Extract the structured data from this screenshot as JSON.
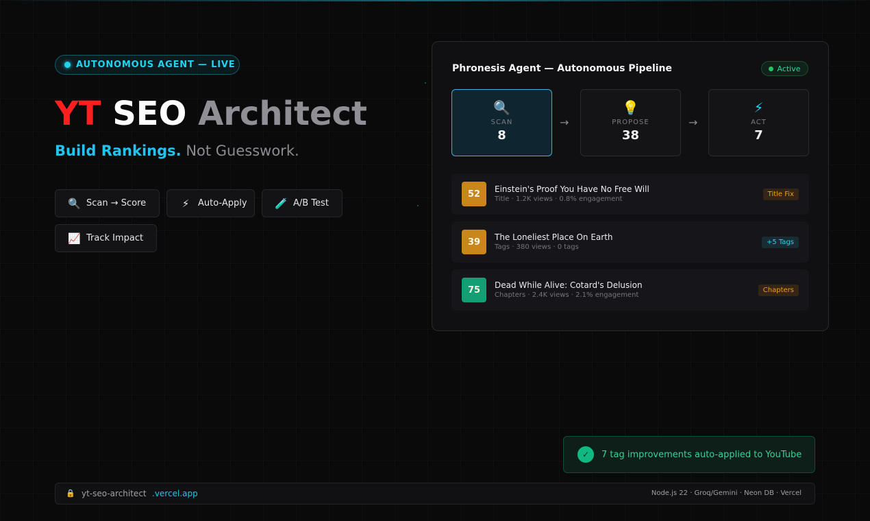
{
  "hero": {
    "badge": "AUTONOMOUS AGENT — LIVE",
    "title_part1": "YT",
    "title_part2": "SEO",
    "title_part3": "Architect",
    "tagline_strong": "Build Rankings.",
    "tagline_muted": "Not Guesswork.",
    "features": [
      {
        "icon": "search-icon",
        "glyph": "🔍",
        "label": "Scan → Score"
      },
      {
        "icon": "lightning-icon",
        "glyph": "⚡",
        "label": "Auto-Apply"
      },
      {
        "icon": "test-tube-icon",
        "glyph": "🧪",
        "label": "A/B Test"
      },
      {
        "icon": "chart-up-icon",
        "glyph": "📈",
        "label": "Track Impact"
      }
    ]
  },
  "pipeline": {
    "title": "Phronesis Agent — Autonomous Pipeline",
    "status": "Active",
    "stages": [
      {
        "icon": "search-icon",
        "glyph": "🔍",
        "label": "SCAN",
        "value": "8"
      },
      {
        "icon": "lightbulb-icon",
        "glyph": "💡",
        "label": "PROPOSE",
        "value": "38"
      },
      {
        "icon": "lightning-icon",
        "glyph": "⚡",
        "label": "ACT",
        "value": "7"
      }
    ],
    "arrow": "→",
    "videos": [
      {
        "score": "52",
        "title": "Einstein's Proof You Have No Free Will",
        "meta": "Title · 1.2K views · 0.8% engagement",
        "badge": "Title Fix"
      },
      {
        "score": "39",
        "title": "The Loneliest Place On Earth",
        "meta": "Tags · 380 views · 0 tags",
        "badge": "+5 Tags"
      },
      {
        "score": "75",
        "title": "Dead While Alive: Cotard's Delusion",
        "meta": "Chapters · 2.4K views · 2.1% engagement",
        "badge": "Chapters"
      }
    ]
  },
  "toast": {
    "icon": "check-icon",
    "glyph": "✓",
    "message": "7 tag improvements auto-applied to YouTube"
  },
  "footer": {
    "lock_glyph": "🔒",
    "url_main": "yt-seo-architect",
    "url_domain": ".vercel.app",
    "stack": "Node.js 22 · Groq/Gemini · Neon DB · Vercel"
  },
  "colors": {
    "accent": "#22d3ee",
    "brand_red": "#ff1f1f",
    "success": "#10b981",
    "score_amber": "#c9861a",
    "score_green": "#139e74"
  }
}
